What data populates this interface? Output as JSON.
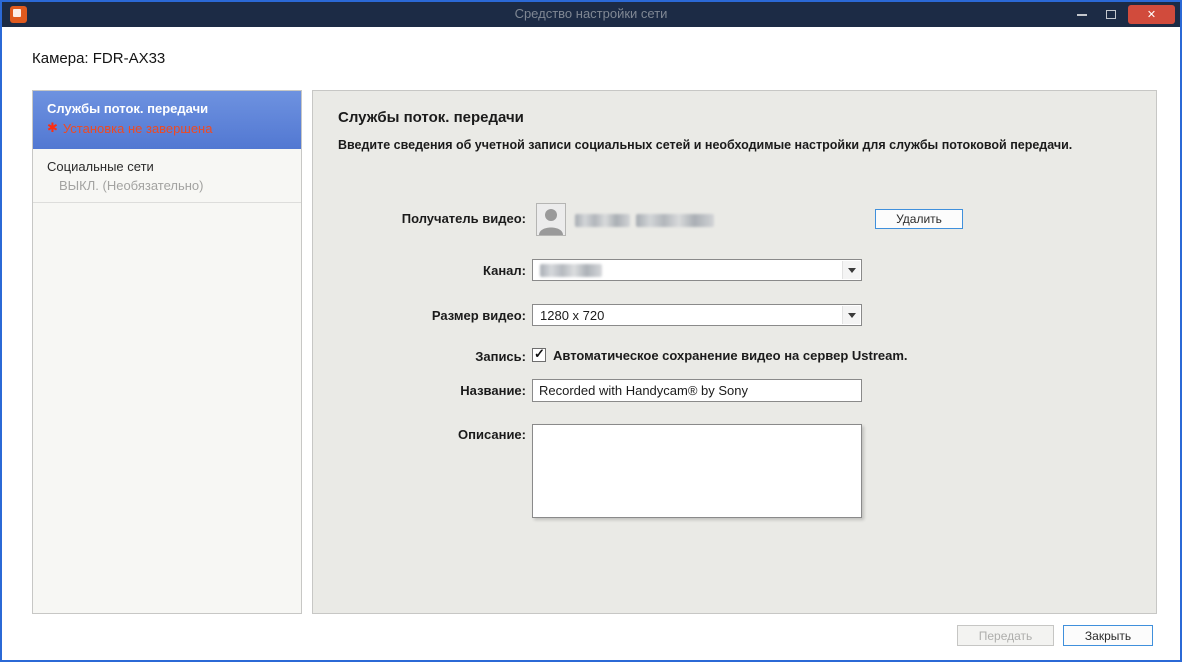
{
  "window": {
    "title": "Средство настройки сети"
  },
  "header": {
    "camera_label": "Камера: FDR-AX33"
  },
  "sidebar": {
    "items": [
      {
        "label": "Службы поток. передачи",
        "status": "Установка не завершена",
        "selected": true
      },
      {
        "label": "Социальные сети",
        "status": "ВЫКЛ. (Необязательно)",
        "selected": false
      }
    ]
  },
  "main": {
    "title": "Службы поток. передачи",
    "description": "Введите сведения об учетной записи социальных сетей и необходимые настройки для службы потоковой передачи.",
    "recipient": {
      "label": "Получатель видео:",
      "delete_button": "Удалить"
    },
    "channel": {
      "label": "Канал:"
    },
    "video_size": {
      "label": "Размер видео:",
      "value": "1280 x 720"
    },
    "record": {
      "label": "Запись:",
      "checkbox_label": "Автоматическое сохранение видео на сервер Ustream.",
      "checked_attr": "checked"
    },
    "title_field": {
      "label": "Название:",
      "value": "Recorded with Handycam® by Sony"
    },
    "description_field": {
      "label": "Описание:",
      "value": ""
    }
  },
  "footer": {
    "transfer_label": "Передать",
    "close_label": "Закрыть"
  },
  "icons": {
    "close": "✕",
    "checkmark": "✓",
    "status_asterisk": "✱"
  },
  "colors": {
    "window_border": "#2b69d6",
    "titlebar": "#1c2b45",
    "close_red": "#d14b3c",
    "selected_blue": "#5b84d8",
    "error_red": "#f04a21",
    "panel_bg": "#eaeae6"
  }
}
